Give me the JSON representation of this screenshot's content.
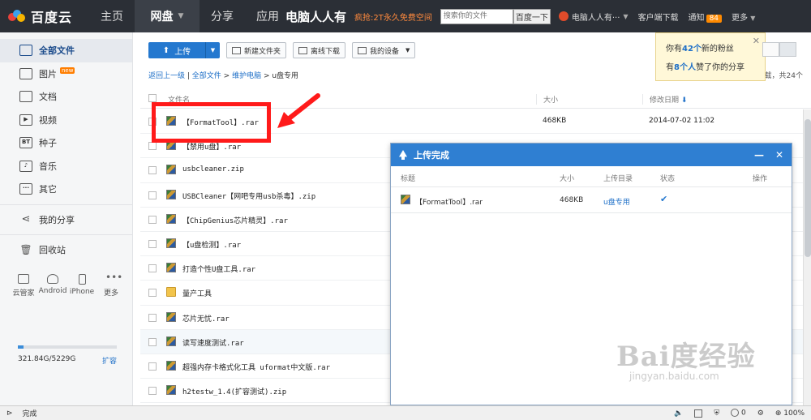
{
  "topbar": {
    "logo": "百度云",
    "nav": [
      {
        "label": "主页"
      },
      {
        "label": "网盘",
        "active": true
      },
      {
        "label": "分享"
      },
      {
        "label": "应用"
      }
    ],
    "brand_overlay": "电脑人人有",
    "promo": "疯抢:2T永久免费空间",
    "search_placeholder": "搜索你的文件",
    "search_button": "百度一下",
    "user_name": "电脑人人有···",
    "client_download": "客户端下载",
    "notice": "通知",
    "notice_count": "84",
    "more": "更多"
  },
  "sidebar": {
    "items": [
      {
        "label": "全部文件",
        "icon": "cloud-folder-icon",
        "active": true
      },
      {
        "label": "图片",
        "icon": "image-icon",
        "badge": "new"
      },
      {
        "label": "文档",
        "icon": "document-icon"
      },
      {
        "label": "视频",
        "icon": "video-icon"
      },
      {
        "label": "种子",
        "icon": "bt-icon",
        "glyph": "BT"
      },
      {
        "label": "音乐",
        "icon": "music-icon"
      },
      {
        "label": "其它",
        "icon": "more-dots-icon"
      }
    ],
    "share_label": "我的分享",
    "trash_label": "回收站",
    "devices": [
      {
        "label": "云管家",
        "icon": "monitor-icon"
      },
      {
        "label": "Android",
        "icon": "android-icon"
      },
      {
        "label": "iPhone",
        "icon": "iphone-icon"
      },
      {
        "label": "更多",
        "icon": "more-icon"
      }
    ],
    "storage": {
      "used": "321.84G/5229G",
      "expand": "扩容",
      "used_fraction": 0.06
    }
  },
  "toolbar": {
    "upload": "上传",
    "new_folder": "新建文件夹",
    "offline_download": "离线下载",
    "my_devices": "我的设备"
  },
  "breadcrumb": {
    "back": "返回上一级",
    "sep": " | ",
    "all": "全部文件",
    "parent": "维护电脑",
    "current": "u盘专用",
    "count": "载，共24个"
  },
  "table": {
    "headers": {
      "name": "文件名",
      "size": "大小",
      "date": "修改日期"
    },
    "rows": [
      {
        "name": "【FormatTool】.rar",
        "size": "468KB",
        "date": "2014-07-02 11:02"
      },
      {
        "name": "【禁用u盘】.rar"
      },
      {
        "name": "usbcleaner.zip"
      },
      {
        "name": "USBCleaner【网吧专用usb杀毒】.zip"
      },
      {
        "name": "【ChipGenius芯片精灵】.rar"
      },
      {
        "name": "【u盘检测】.rar"
      },
      {
        "name": "打造个性U盘工具.rar"
      },
      {
        "name": "量产工具",
        "folder": true
      },
      {
        "name": "芯片无忧.rar"
      },
      {
        "name": "读写速度测试.rar",
        "highlight": true
      },
      {
        "name": "超强内存卡格式化工具 uformat中文版.rar"
      },
      {
        "name": "h2testw_1.4(扩容测试).zip"
      }
    ]
  },
  "popover": {
    "line1_pre": "你有",
    "line1_num": "42个",
    "line1_post": "新的粉丝",
    "line2_pre": "有",
    "line2_num": "8个人",
    "line2_post": "赞了你的分享"
  },
  "dialog": {
    "title": "上传完成",
    "cols": {
      "title": "标题",
      "size": "大小",
      "dir": "上传目录",
      "status": "状态",
      "action": "操作"
    },
    "row": {
      "name": "【FormatTool】.rar",
      "size": "468KB",
      "dir": "u盘专用",
      "status": "✔"
    }
  },
  "statusbar": {
    "text": "完成",
    "zoom": "100%",
    "count": "0"
  },
  "watermark": {
    "big": "Bai度经验",
    "small": "jingyan.baidu.com"
  },
  "colors": {
    "accent": "#2478cf",
    "highlight": "#ff1a1a",
    "topbar": "#2b2f36"
  }
}
